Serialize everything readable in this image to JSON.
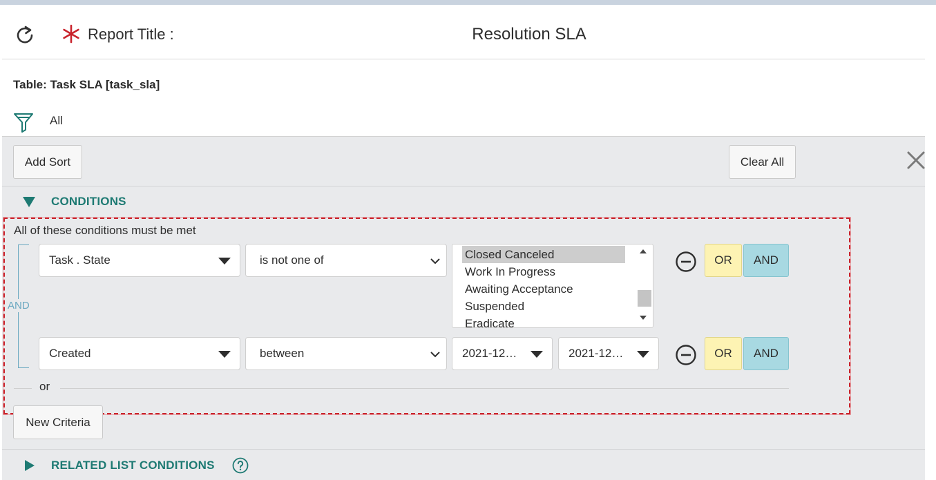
{
  "header": {
    "required_marker": "*",
    "report_title_label": "Report Title :",
    "report_title_value": "Resolution SLA"
  },
  "table_info": {
    "table_label": "Table: Task SLA [task_sla]",
    "filter_summary": "All"
  },
  "toolbar": {
    "add_sort_label": "Add Sort",
    "clear_all_label": "Clear All"
  },
  "conditions": {
    "section_label": "CONDITIONS",
    "note": "All of these conditions must be met",
    "group_joiner": "AND",
    "rows": [
      {
        "field": "Task . State",
        "operator": "is not one of",
        "values": [
          "Closed Canceled",
          "Work In Progress",
          "Awaiting Acceptance",
          "Suspended",
          "Eradicate"
        ],
        "selected_value": "Closed Canceled",
        "or_label": "OR",
        "and_label": "AND"
      },
      {
        "field": "Created",
        "operator": "between",
        "date_from": "2021-12…",
        "date_to": "2021-12…",
        "or_label": "OR",
        "and_label": "AND"
      }
    ],
    "or_separator": "or",
    "new_criteria_label": "New Criteria"
  },
  "related": {
    "section_label": "RELATED LIST CONDITIONS"
  },
  "colors": {
    "accent_teal": "#1e7a73",
    "or_yellow": "#fdf3b3",
    "and_blue": "#a8d9e2",
    "selection_red": "#c9232c",
    "panel_gray": "#e9eaec"
  }
}
